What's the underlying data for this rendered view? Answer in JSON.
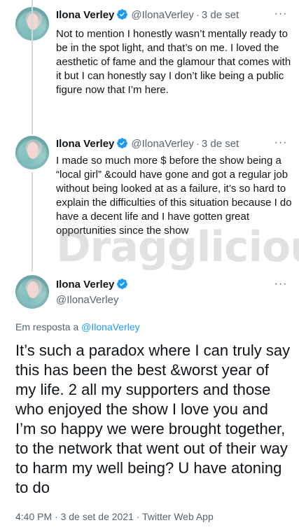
{
  "tweets": [
    {
      "name": "Ilona Verley",
      "handle": "@IlonaVerley",
      "date": "3 de set",
      "text": "Not to mention I honestly wasn’t mentally ready to be in the spot light, and that’s on me. I loved the aesthetic of fame and the glamour that comes with it but I can honestly say I don’t like being a public figure now that I’m here."
    },
    {
      "name": "Ilona Verley",
      "handle": "@IlonaVerley",
      "date": "3 de set",
      "text": "I made so much more $ before the show being a “local girl” &could have gone and got a regular job without being looked at as a failure, it’s so hard to explain the difficulties of this situation because I do have a decent life and I have gotten great opportunities since the show"
    }
  ],
  "focused_tweet": {
    "name": "Ilona Verley",
    "handle": "@IlonaVerley",
    "reply_prefix": "Em resposta a",
    "reply_handle": "@IlonaVerley",
    "text": "It’s such a paradox where I can truly say this has been the best &worst year of my life. 2 all my supporters and those who enjoyed the show I love you and I’m so happy we were brought together, to the network that went out of their way to harm my well being? U have atoning to do",
    "timestamp": "4:40 PM · 3 de set de 2021 · Twitter Web App"
  },
  "watermark": "Dragglicious",
  "more_label": "···",
  "separator": "·",
  "colors": {
    "verified": "#1d9bf0",
    "link": "#1d9bf0",
    "secondary": "#536471"
  }
}
